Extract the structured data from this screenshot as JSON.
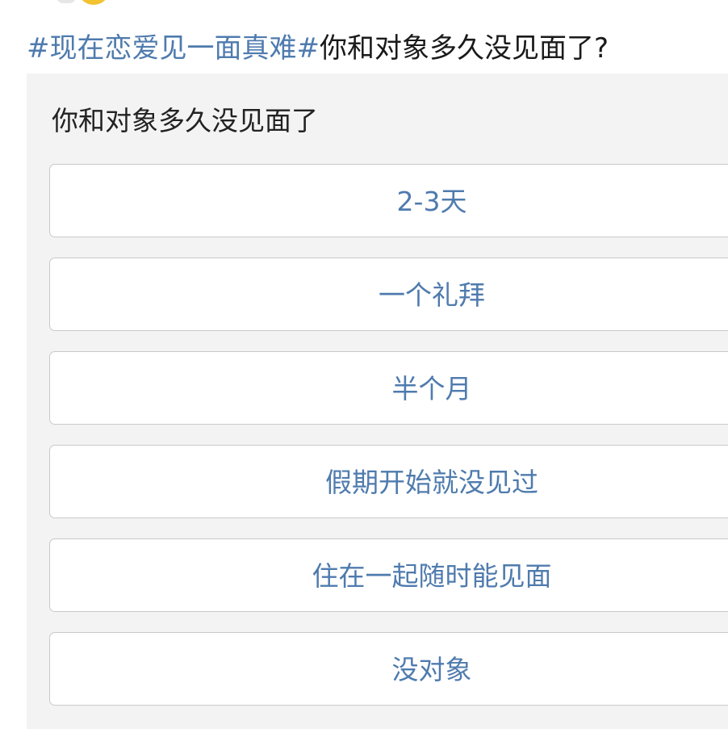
{
  "post": {
    "hashtag": "#现在恋爱见一面真难#",
    "title_text": "你和对象多久没见面了?"
  },
  "poll": {
    "question": "你和对象多久没见面了",
    "options": [
      {
        "label": "2-3天"
      },
      {
        "label": "一个礼拜"
      },
      {
        "label": "半个月"
      },
      {
        "label": "假期开始就没见过"
      },
      {
        "label": "住在一起随时能见面"
      },
      {
        "label": "没对象"
      }
    ]
  },
  "colors": {
    "link": "#4f7bae",
    "text": "#1a1a1a",
    "card_bg": "#f3f3f3",
    "option_border": "#c9c9c9"
  }
}
